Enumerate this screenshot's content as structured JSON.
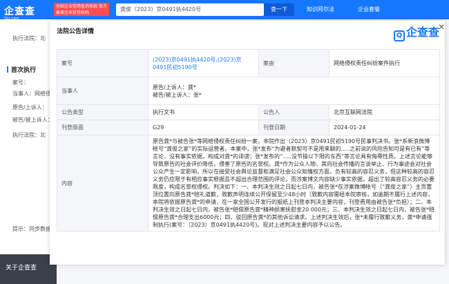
{
  "header": {
    "logo": "企查查",
    "logo_sub": "Qcc.com",
    "tagline": "全国企业信用查询系统 官方备案企业征信机构",
    "search_value": "龚俊（2023）京0491执4420号",
    "search_button": "查一下",
    "links": [
      "知识阿尔法",
      "企业套餐"
    ]
  },
  "background": {
    "items": [
      "执行法院：北",
      "首次执行",
      "案号：",
      "当事人：网络侵",
      "原告/上诉人：",
      "被告/被上诉人：",
      "执行法院：北",
      "提示：同步数据"
    ],
    "footer": "关于企查查"
  },
  "modal": {
    "title": "法院公告详情",
    "brand": "企查查",
    "labels": {
      "case_no": "案号",
      "cause": "案由",
      "party": "当事人",
      "type": "公告类型",
      "announcer": "公告人",
      "page": "刊登版面",
      "date": "刊登日期",
      "content": "内容"
    },
    "case_no_value": "(2023)京0491执4420号,(2023)京0491民初5190号",
    "cause_value": "网络侵权责任纠纷案件执行",
    "party_plaintiff": "原告/上诉人：龚*",
    "party_defendant": "被告/被上诉人：张*",
    "type_value": "执行文书",
    "announcer_value": "北京互联网法院",
    "page_value": "G29",
    "date_value": "2024-01-24",
    "content_value": "原告龚*与被告张*等网络侵权责任纠纷一案，本院作出（2023）京0491民初5190号民事判决书。张*系新浪微博帐号“龚俊之家”的实际运营者。本案中，张*发布“为避者默契可不是用来聊的.....之前说的风险告知可是有已有”等言论，没有事实依据，构成对龚*的诽谤；张*发布的“.....没节操以下限的东西”等言论具有侮辱性质。上述言论能够导致原告的社会评价降低，侵害了原告的名誉权。龚*作为公众人物，其向社会传播的言谈举止、行为事迹会对社会公众产生一定影响，所以在接受社会舆论监督和满足社会公众知情权方面，负有较高的容忍义务，但这种较高的容忍义务仍应限于有相应事实根据且不超出合理范围的评论，而涉案博文内容缺少事实依据，超出了较高容忍义务的必要限度，构成名誉权侵权。判决如下：一、本判决生效之日起七日内，被告张*在涉案微博帐号（“龚俊之家”）主页置顶位置向原告龚*赔礼道歉，致歉声明连续公开保留至少48小时（致歉内容需经本院审核，如逾期不履行上述内容，本院将依据原告龚*的申请，在一家全国公开发行的报纸上刊登本判决主要内容，刊登费用由被告张*负担）；二、本判决生效之日起七日内，被告张*赔偿原告龚*精神损害抚慰金20 000元；三、本判决生效之日起七日内，被告张*赔偿原告龚*合理支出6000元；四、驳回原告龚*的其他诉讼请求。上述判决生效后，张*未履行致歉义务，龚*申请强制执行(案号：（2023）京0491执4420号)。现对上述判决主要内容予以公告。"
  }
}
